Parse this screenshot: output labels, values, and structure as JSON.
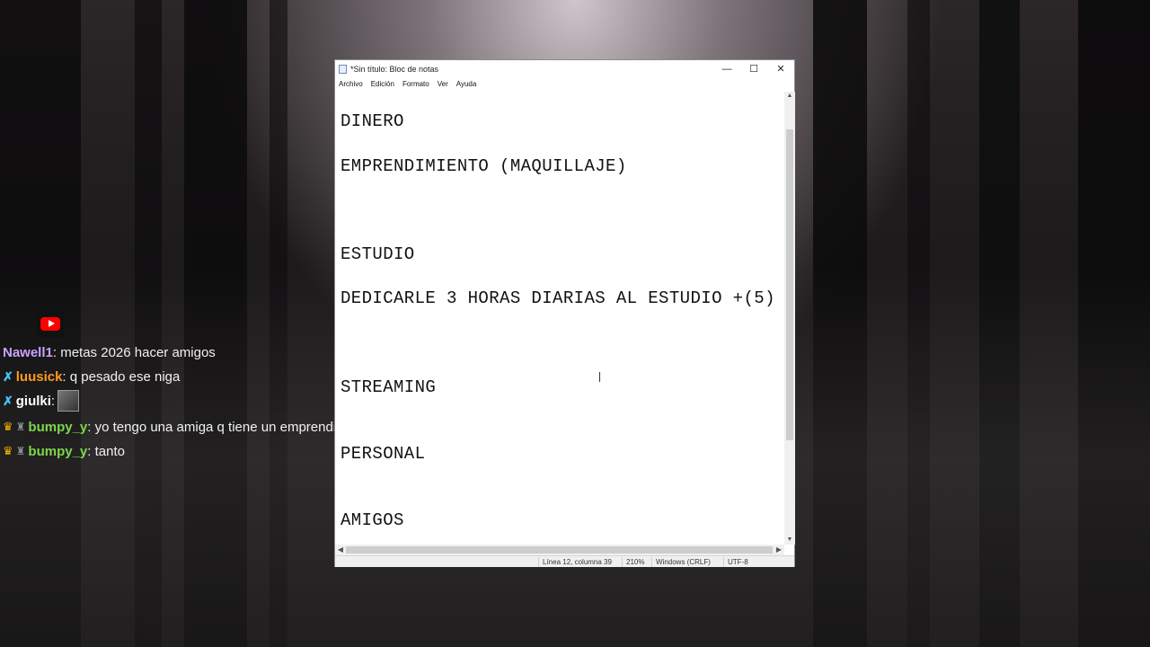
{
  "notepad": {
    "title": "*Sin título: Bloc de notas",
    "controls": {
      "minimize": "—",
      "maximize": "☐",
      "close": "✕"
    },
    "menu": [
      "Archivo",
      "Edición",
      "Formato",
      "Ver",
      "Ayuda"
    ],
    "lines": [
      "DINERO",
      "EMPRENDIMIENTO (MAQUILLAJE)",
      "ESTUDIO",
      "DEDICARLE 3 HORAS DIARIAS AL ESTUDIO +(5)",
      "STREAMING",
      "PERSONAL",
      "AMIGOS"
    ],
    "status": {
      "position": "Línea 12, columna 39",
      "zoom": "210%",
      "line_ending": "Windows (CRLF)",
      "encoding": "UTF-8"
    }
  },
  "chat": {
    "messages": [
      {
        "user": "Nawell1",
        "text": ": metas 2026 hacer amigos",
        "color": "#c9a2ff"
      },
      {
        "user": "luusick",
        "text": ": q pesado ese niga",
        "color": "#ff9a1f"
      },
      {
        "user": "giulki",
        "text": ":",
        "color": "#ffffff"
      },
      {
        "user": "bumpy_y",
        "text": ": yo tengo una amiga q tiene un emprendimiento de maquillaje",
        "color": "#7cd84a"
      },
      {
        "user": "bumpy_y",
        "text": ": tanto",
        "color": "#7cd84a"
      }
    ]
  },
  "colors": {
    "youtube_red": "#ff0000"
  },
  "icons": {
    "platform": "youtube-icon"
  }
}
